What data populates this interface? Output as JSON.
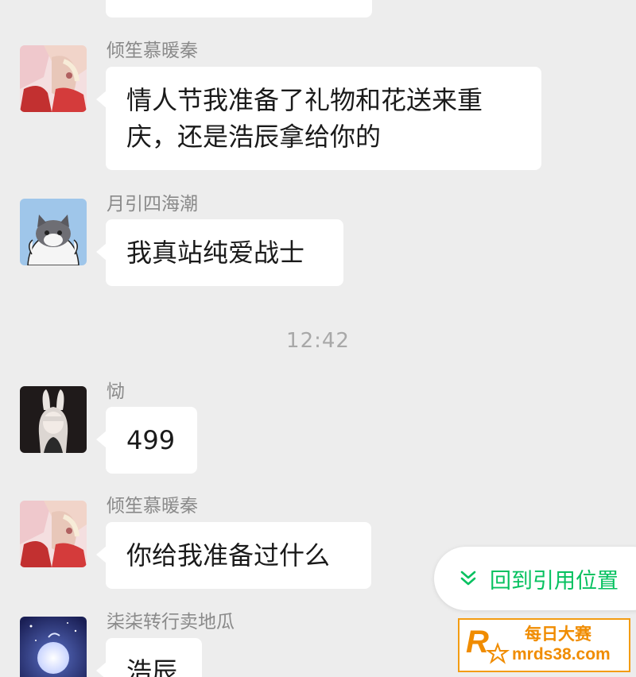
{
  "chat": {
    "messages": [
      {
        "sender": "",
        "text": "",
        "avatar": "none"
      },
      {
        "sender": "倾笙慕暖秦",
        "text": "情人节我准备了礼物和花送来重\n庆，还是浩辰拿给你的",
        "avatar": "anime-girl-red-avatar"
      },
      {
        "sender": "月引四海潮",
        "text": "我真站纯爱战士",
        "avatar": "cat-avatar"
      },
      {
        "sender": "恸",
        "text": "499",
        "avatar": "bunny-girl-dark-avatar"
      },
      {
        "sender": "倾笙慕暖秦",
        "text": "你给我准备过什么",
        "avatar": "anime-girl-red-avatar"
      },
      {
        "sender": "柒柒转行卖地瓜",
        "text": "浩辰",
        "avatar": "moon-night-avatar"
      }
    ],
    "timestamp": "12:42"
  },
  "jump_button": {
    "label": "回到引用位置",
    "icon": "double-chevron-down-icon",
    "color": "#07c160"
  },
  "watermark": {
    "line1": "每日大赛",
    "line2": "mrds38.com",
    "logo_letter": "R",
    "color": "#f08c00"
  },
  "colors": {
    "background": "#ededed",
    "bubble": "#ffffff",
    "sender_name": "#8a8a8a",
    "timestamp": "#a8a8a8"
  }
}
